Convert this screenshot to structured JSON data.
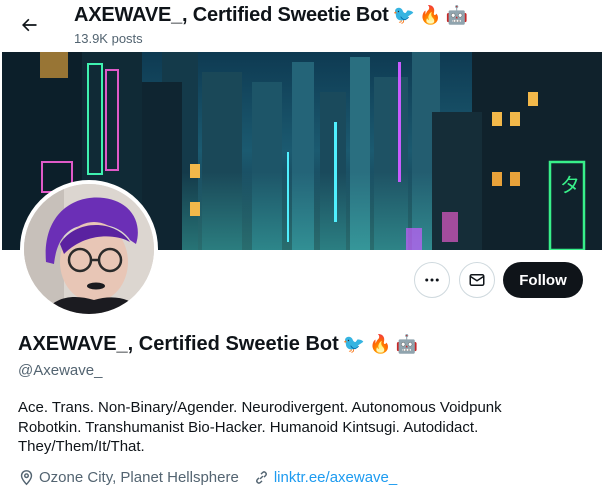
{
  "header": {
    "title": "AXEWAVE_, Certified Sweetie Bot",
    "title_emojis": [
      "🐦",
      "🔥",
      "🤖"
    ],
    "post_count": "13.9K posts"
  },
  "profile": {
    "display_name": "AXEWAVE_, Certified Sweetie Bot",
    "name_emojis": [
      "🐦",
      "🔥",
      "🤖"
    ],
    "handle": "@Axewave_",
    "bio_line1": "Ace. Trans. Non-Binary/Agender. Neurodivergent. Autonomous Voidpunk",
    "bio_line2": "Robotkin. Transhumanist Bio-Hacker. Humanoid Kintsugi. Autodidact.",
    "bio_line3": "They/Them/It/That.",
    "location": "Ozone City, Planet Hellsphere",
    "website": "linktr.ee/axewave_"
  },
  "actions": {
    "follow_label": "Follow"
  },
  "icons": {
    "back": "arrow-left-icon",
    "more": "more-horizontal-icon",
    "message": "envelope-icon",
    "location": "location-pin-icon",
    "link": "link-icon"
  },
  "colors": {
    "follow_bg": "#0f1419",
    "link": "#1d9bf0",
    "secondary_text": "#536471",
    "border": "#cfd9de"
  }
}
